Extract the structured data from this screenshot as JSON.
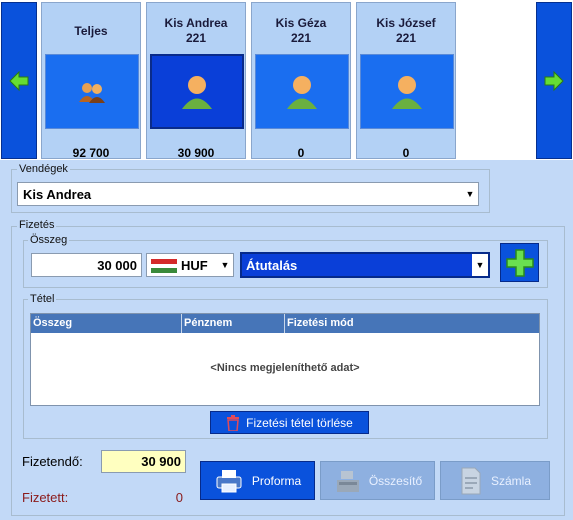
{
  "guests": [
    {
      "name": "Teljes",
      "sub": "",
      "amount": "92 700",
      "selected": false
    },
    {
      "name": "Kis Andrea",
      "sub": "221",
      "amount": "30 900",
      "selected": true
    },
    {
      "name": "Kis Géza",
      "sub": "221",
      "amount": "0",
      "selected": false
    },
    {
      "name": "Kis József",
      "sub": "221",
      "amount": "0",
      "selected": false
    }
  ],
  "vendegek": {
    "label": "Vendégek",
    "selected": "Kis Andrea"
  },
  "fizetes": {
    "label": "Fizetés",
    "osszeg_label": "Összeg",
    "amount": "30 000",
    "currency": "HUF",
    "method": "Átutalás"
  },
  "tetel": {
    "label": "Tétel",
    "columns": [
      "Összeg",
      "Pénznem",
      "Fizetési mód"
    ],
    "empty": "<Nincs megjeleníthető adat>",
    "delete_button": "Fizetési tétel törlése"
  },
  "summary": {
    "fizetendo_label": "Fizetendő:",
    "fizetendo_value": "30 900",
    "fizetett_label": "Fizetett:",
    "fizetett_value": "0"
  },
  "buttons": {
    "proforma": "Proforma",
    "osszesito": "Összesítő",
    "szamla": "Számla"
  },
  "colors": {
    "accent": "#0a52dc",
    "selected_pic": "#0a3fd8",
    "header": "#4675b8",
    "input_highlight": "#ffffc0",
    "fizetett_red": "#8b1a1a"
  }
}
